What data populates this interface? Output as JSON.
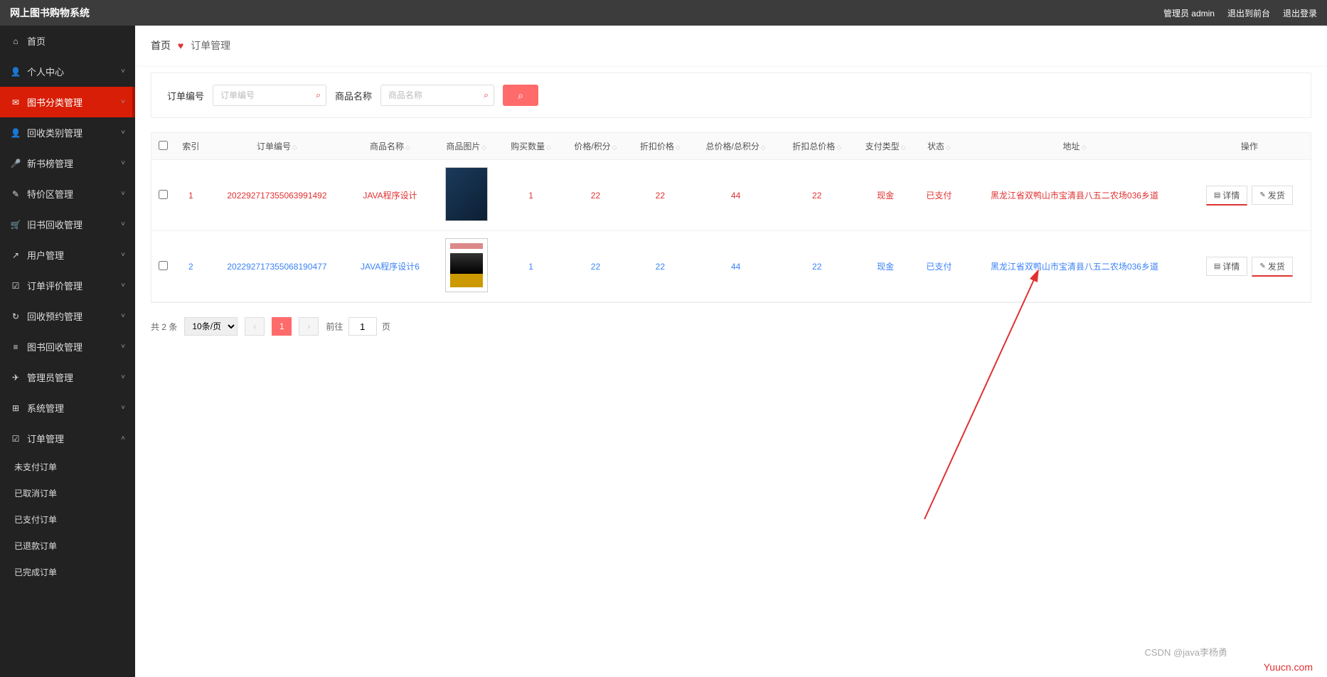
{
  "header": {
    "title": "网上图书购物系统",
    "admin_label": "管理员 admin",
    "back_label": "退出到前台",
    "logout_label": "退出登录"
  },
  "sidebar": {
    "items": [
      {
        "label": "首页",
        "icon": "⌂",
        "expand": false
      },
      {
        "label": "个人中心",
        "icon": "👤",
        "expand": true
      },
      {
        "label": "图书分类管理",
        "icon": "✉",
        "expand": true,
        "active": true
      },
      {
        "label": "回收类别管理",
        "icon": "👤",
        "expand": true
      },
      {
        "label": "新书榜管理",
        "icon": "🎤",
        "expand": true
      },
      {
        "label": "特价区管理",
        "icon": "✎",
        "expand": true
      },
      {
        "label": "旧书回收管理",
        "icon": "🛒",
        "expand": true
      },
      {
        "label": "用户管理",
        "icon": "↗",
        "expand": true
      },
      {
        "label": "订单评价管理",
        "icon": "☑",
        "expand": true
      },
      {
        "label": "回收预约管理",
        "icon": "↻",
        "expand": true
      },
      {
        "label": "图书回收管理",
        "icon": "≡",
        "expand": true
      },
      {
        "label": "管理员管理",
        "icon": "✈",
        "expand": true
      },
      {
        "label": "系统管理",
        "icon": "⊞",
        "expand": true
      },
      {
        "label": "订单管理",
        "icon": "☑",
        "expand": true,
        "open": true
      }
    ],
    "subitems": [
      {
        "label": "未支付订单"
      },
      {
        "label": "已取消订单"
      },
      {
        "label": "已支付订单"
      },
      {
        "label": "已退款订单"
      },
      {
        "label": "已完成订单"
      }
    ]
  },
  "breadcrumb": {
    "home": "首页",
    "current": "订单管理"
  },
  "filters": {
    "order_label": "订单编号",
    "order_ph": "订单编号",
    "product_label": "商品名称",
    "product_ph": "商品名称"
  },
  "table": {
    "headers": [
      "索引",
      "订单编号",
      "商品名称",
      "商品图片",
      "购买数量",
      "价格/积分",
      "折扣价格",
      "总价格/总积分",
      "折扣总价格",
      "支付类型",
      "状态",
      "地址",
      "操作"
    ],
    "rows": [
      {
        "idx": "1",
        "no": "202292717355063991492",
        "name": "JAVA程序设计",
        "qty": "1",
        "price": "22",
        "disc": "22",
        "total": "44",
        "disc_total": "22",
        "pay": "现金",
        "status": "已支付",
        "addr": "黑龙江省双鸭山市宝清县八五二农场036乡道"
      },
      {
        "idx": "2",
        "no": "202292717355068190477",
        "name": "JAVA程序设计6",
        "qty": "1",
        "price": "22",
        "disc": "22",
        "total": "44",
        "disc_total": "22",
        "pay": "现金",
        "status": "已支付",
        "addr": "黑龙江省双鸭山市宝清县八五二农场036乡道"
      }
    ],
    "detail_btn": "详情",
    "ship_btn": "发货"
  },
  "pager": {
    "total": "共 2 条",
    "per_page": "10条/页",
    "current_page": "1",
    "goto_prefix": "前往",
    "goto_value": "1",
    "goto_suffix": "页"
  },
  "watermark1": "Yuucn.com",
  "watermark2": "CSDN @java李杨勇"
}
